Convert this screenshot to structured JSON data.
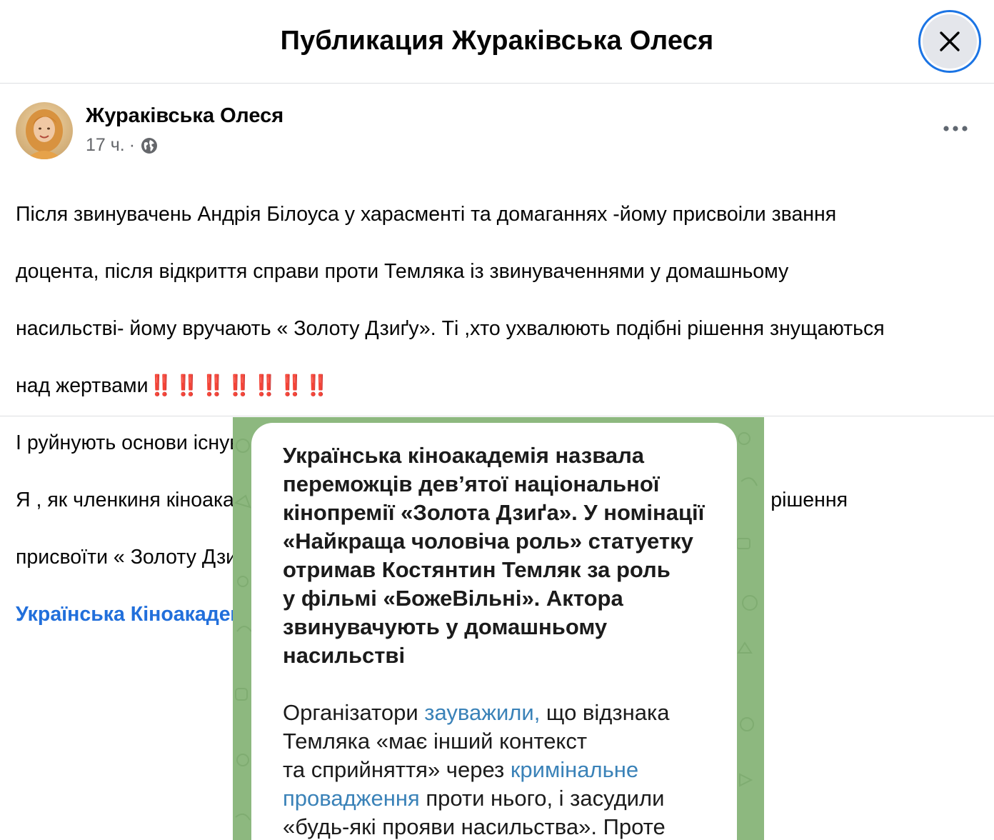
{
  "header": {
    "title": "Публикация Жураківська Олеся",
    "close_icon": "close-icon"
  },
  "post": {
    "author": "Жураківська Олеся",
    "time": "17 ч.",
    "dot": "·",
    "privacy_icon": "globe-icon",
    "more_icon": "more-horizontal-icon",
    "lines": [
      "Після звинувачень Андрія Білоуса у харасменті та домаганнях -йому присвоіли звання",
      "доцента, після відкриття справи проти Темляка із звинуваченнями у домашньому",
      "насильстві- йому вручають « Золоту Дзиґу». Ті ,хто ухвалюють подібні рішення знущаються",
      "над жертвами",
      "І руйнують основи існування цивілізованого суспільства.",
      "Я , як членкиня кіноакадемії , жінка, громадянка висловлюю свій протест   проти  рішення",
      "присвоїти « Золоту Дзигу» за головну чоловічу роль Костянтину Темляку"
    ],
    "bangs": "‼️‼️‼️‼️‼️‼️‼️",
    "link": "Українська Кіноакадемія"
  },
  "image": {
    "headline_lines": [
      "Українська кіноакадемія назвала",
      "переможців дев’ятої національної",
      "кінопремії «Золота Дзиґа». У номінації",
      "«Найкраща чоловіча роль» статуетку",
      "отримав Костянтин Темляк за роль",
      "у фільмі «БожеВільні». Актора",
      "звинувачують у домашньому",
      "насильстві"
    ],
    "body": {
      "l1_a": "Організатори ",
      "l1_link": "зауважили,",
      "l1_b": " що відзнака",
      "l2": "Темляка «має інший контекст",
      "l3_a": "та сприйняття» через ",
      "l3_link": "кримінальне",
      "l4_link": "провадження",
      "l4_b": " проти нього, і засудили",
      "l5": "«будь-які прояви насильства». Проте"
    }
  },
  "colors": {
    "accent": "#1b74e4",
    "link": "#216fdb",
    "meta": "#65676b",
    "bangs": "#e0262b",
    "telegram_bg": "#8db87f",
    "telegram_link": "#3a82b8"
  }
}
